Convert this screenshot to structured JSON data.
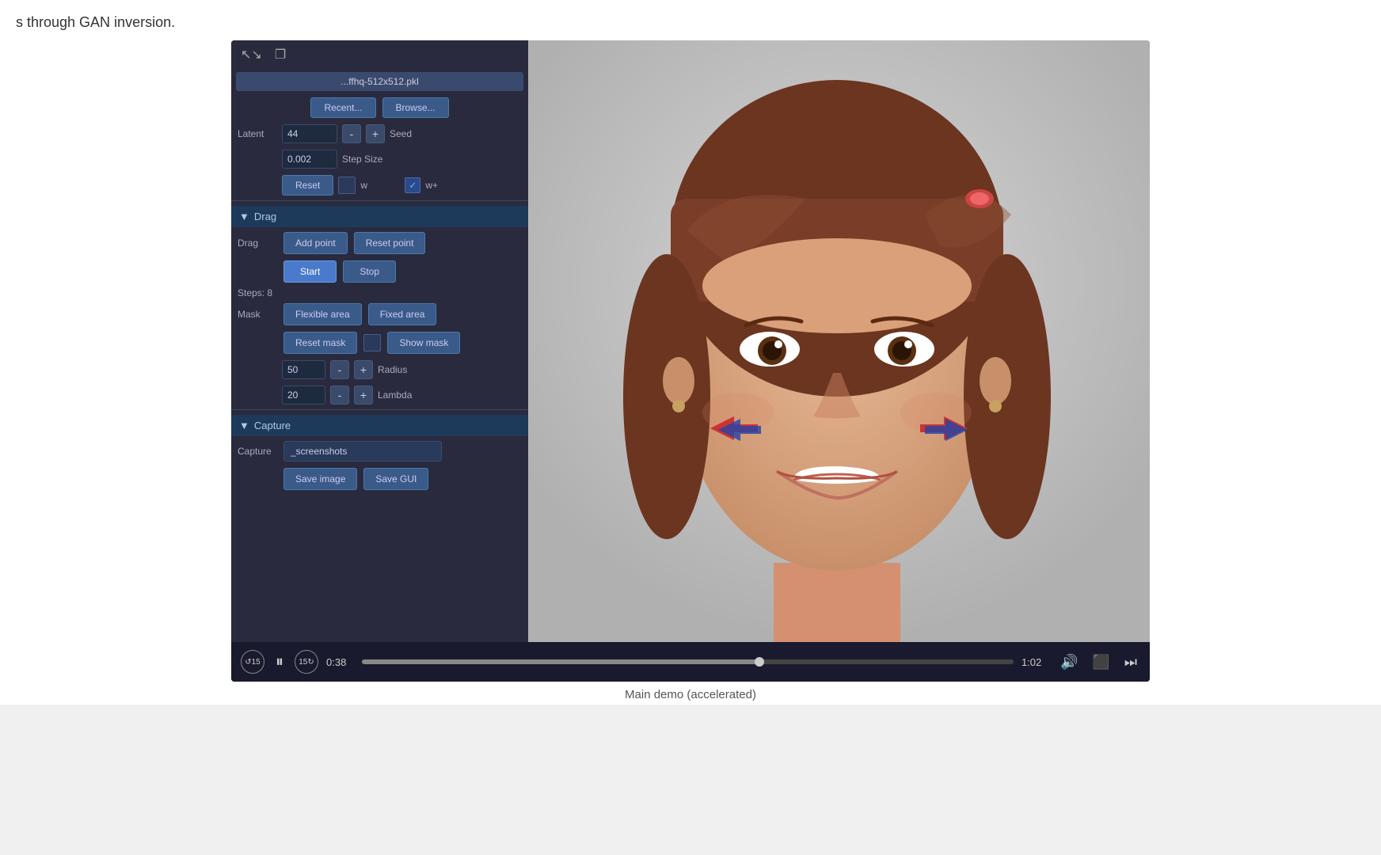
{
  "header": {
    "title_text": "s through GAN inversion."
  },
  "toolbar": {
    "file_path": "...ffhq-512x512.pkl",
    "recent_label": "Recent...",
    "browse_label": "Browse..."
  },
  "latent_section": {
    "label": "Latent",
    "seed_value": "44",
    "seed_label": "Seed",
    "minus_label": "-",
    "plus_label": "+",
    "step_size_value": "0.002",
    "step_size_label": "Step Size",
    "reset_label": "Reset",
    "w_label": "w",
    "wplus_label": "w+"
  },
  "drag_section": {
    "header_label": "Drag",
    "drag_label": "Drag",
    "add_point_label": "Add point",
    "reset_point_label": "Reset point",
    "start_label": "Start",
    "stop_label": "Stop",
    "steps_text": "Steps: 8",
    "mask_label": "Mask",
    "flexible_area_label": "Flexible area",
    "fixed_area_label": "Fixed area",
    "reset_mask_label": "Reset mask",
    "show_mask_label": "Show mask",
    "radius_value": "50",
    "radius_label": "Radius",
    "lambda_value": "20",
    "lambda_label": "Lambda"
  },
  "capture_section": {
    "header_label": "Capture",
    "capture_label": "Capture",
    "screenshots_value": "_screenshots",
    "save_image_label": "Save image",
    "save_gui_label": "Save GUI"
  },
  "video_controls": {
    "rewind_label": "⟳15",
    "pause_label": "⏸",
    "forward_label": "⟳15",
    "current_time": "0:38",
    "total_time": "1:02",
    "volume_label": "🔊",
    "airplay_label": "⬛",
    "skip_label": "⏭"
  },
  "video_caption": "Main demo (accelerated)",
  "progress": {
    "percent": 61
  }
}
